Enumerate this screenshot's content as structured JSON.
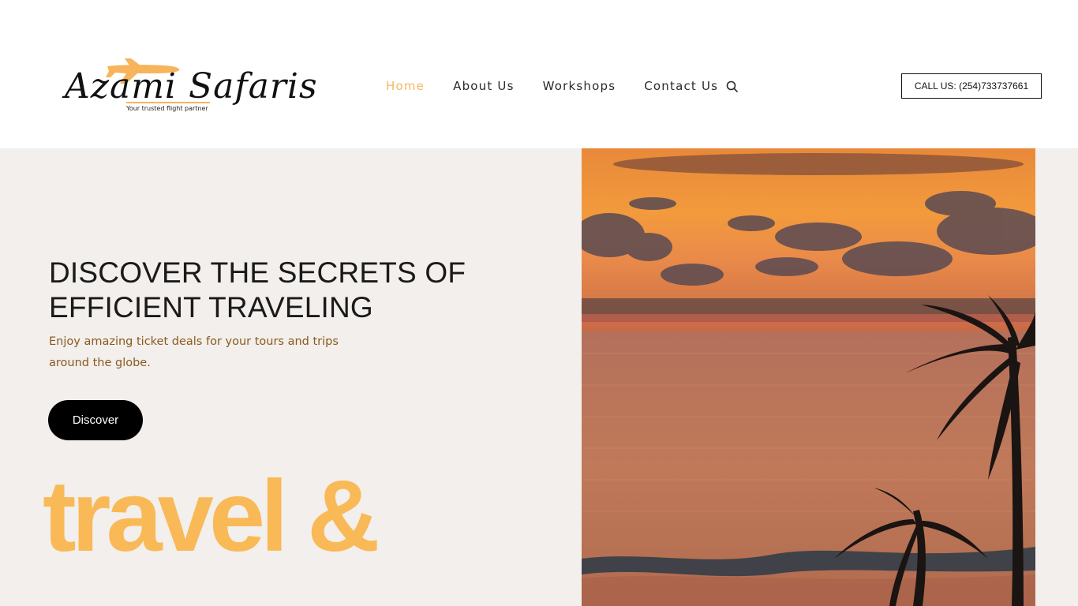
{
  "header": {
    "logo": {
      "wordmark": "Azami Safaris",
      "tagline": "Your trusted flight partner"
    },
    "nav": [
      {
        "label": "Home",
        "active": true
      },
      {
        "label": "About Us",
        "active": false
      },
      {
        "label": "Workshops",
        "active": false
      },
      {
        "label": "Contact Us",
        "active": false
      }
    ],
    "call_button": "CALL US: (254)733737661"
  },
  "hero": {
    "title": "DISCOVER THE SECRETS OF EFFICIENT TRAVELING",
    "subtitle": "Enjoy amazing ticket deals for your tours and trips around the globe.",
    "cta": "Discover",
    "big_text": "travel &"
  },
  "colors": {
    "accent": "#f4b862",
    "big_text": "#f9b957",
    "hero_bg": "#f2efec",
    "subtitle": "#8a5a1c",
    "button_bg": "#000000"
  },
  "icons": {
    "logo_plane": "airplane-icon",
    "search": "search-icon"
  }
}
